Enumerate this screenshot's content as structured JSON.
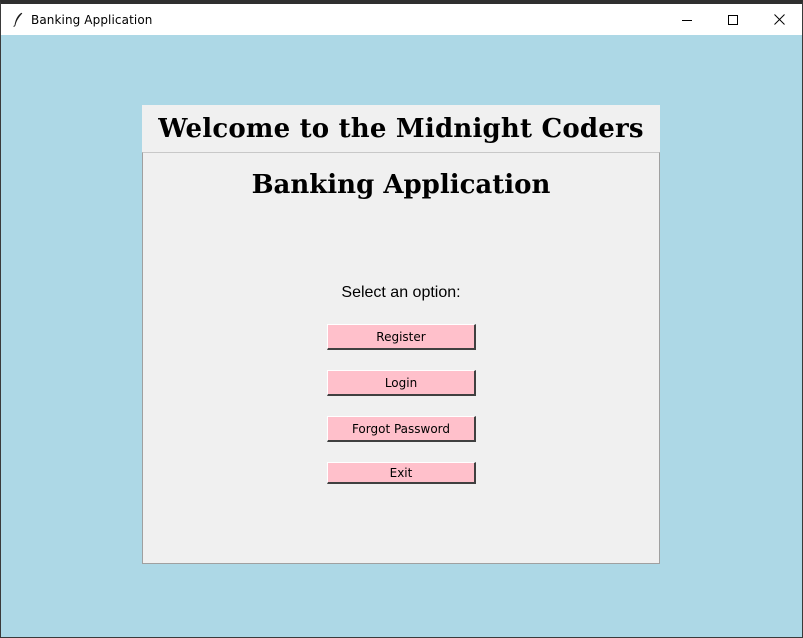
{
  "window": {
    "title": "Banking Application",
    "icon": "feather-icon",
    "controls": [
      "minimize-icon",
      "maximize-icon",
      "close-icon"
    ]
  },
  "header": {
    "welcome": "Welcome to the Midnight Coders",
    "app_name": "Banking Application"
  },
  "menu": {
    "prompt": "Select an option:",
    "register_label": "Register",
    "login_label": "Login",
    "forgot_label": "Forgot Password",
    "exit_label": "Exit"
  },
  "colors": {
    "background": "#add8e6",
    "panel": "#f0f0f0",
    "button": "#ffc0cb"
  }
}
